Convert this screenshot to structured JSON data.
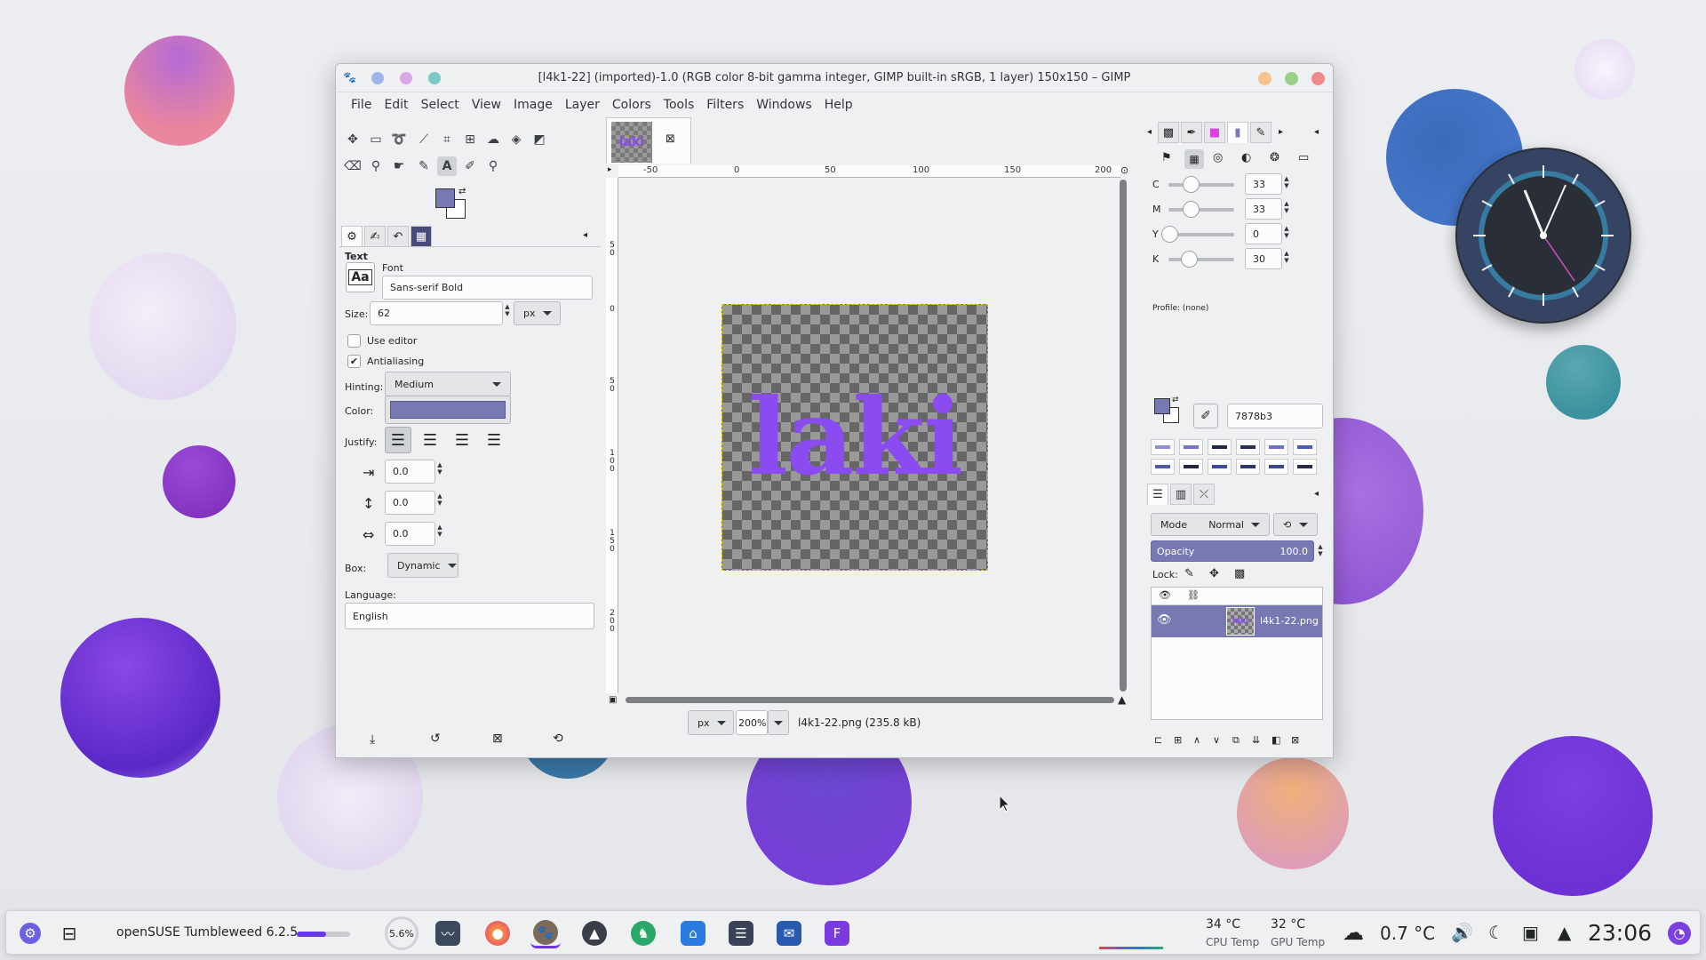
{
  "window": {
    "title": "[l4k1-22] (imported)-1.0 (RGB color 8-bit gamma integer, GIMP built-in sRGB, 1 layer) 150x150 – GIMP"
  },
  "menubar": [
    "File",
    "Edit",
    "Select",
    "View",
    "Image",
    "Layer",
    "Colors",
    "Tools",
    "Filters",
    "Windows",
    "Help"
  ],
  "tool_options": {
    "heading": "Text",
    "font_label": "Font",
    "font_icon": "Aa",
    "font_value": "Sans-serif Bold",
    "size_label": "Size:",
    "size_value": "62",
    "size_unit": "px",
    "use_editor": "Use editor",
    "antialiasing": "Antialiasing",
    "hinting_label": "Hinting:",
    "hinting_value": "Medium",
    "color_label": "Color:",
    "color_value": "#7878b3",
    "justify_label": "Justify:",
    "indent_value": "0.0",
    "line_spacing_value": "0.0",
    "letter_spacing_value": "0.0",
    "box_label": "Box:",
    "box_value": "Dynamic",
    "language_label": "Language:",
    "language_value": "English"
  },
  "canvas": {
    "image_text": "laki",
    "text_color": "#8a4cf0",
    "hruler_ticks": [
      "-50",
      "0",
      "50",
      "100",
      "150",
      "200"
    ],
    "vruler_ticks": [
      "5\n0",
      "0",
      "5\n0",
      "1\n0\n0",
      "1\n5\n0",
      "2\n0\n0"
    ],
    "unit": "px",
    "zoom": "200%",
    "status": "l4k1-22.png (235.8 kB)"
  },
  "color_panel": {
    "channels": [
      {
        "label": "C",
        "value": "33",
        "fraction": 0.33
      },
      {
        "label": "M",
        "value": "33",
        "fraction": 0.33
      },
      {
        "label": "Y",
        "value": "0",
        "fraction": 0.0
      },
      {
        "label": "K",
        "value": "30",
        "fraction": 0.3
      }
    ],
    "profile": "Profile: (none)",
    "fg_color": "#7878b3",
    "hex_value": "7878b3",
    "history": [
      "#8d8fd4",
      "#7276c6",
      "#23264a",
      "#2b2f58",
      "#6b71c4",
      "#4e5bb4",
      "#5059ab",
      "#222646",
      "#3c4a9f",
      "#2d3468",
      "#3a4689",
      "#23284d"
    ]
  },
  "layers_panel": {
    "mode_label": "Mode",
    "mode_value": "Normal",
    "opacity_label": "Opacity",
    "opacity_value": "100.0",
    "lock_label": "Lock:",
    "layer_name": "l4k1-22.png"
  },
  "taskbar": {
    "distro": "openSUSE Tumbleweed 6.2.5",
    "cpu_usage": "5.6%",
    "cpu_temp_value": "34 °C",
    "cpu_temp_label": "CPU Temp",
    "gpu_temp_value": "32 °C",
    "gpu_temp_label": "GPU Temp",
    "weather": "0.7 °C",
    "clock": "23:06",
    "progress": 0.55
  }
}
